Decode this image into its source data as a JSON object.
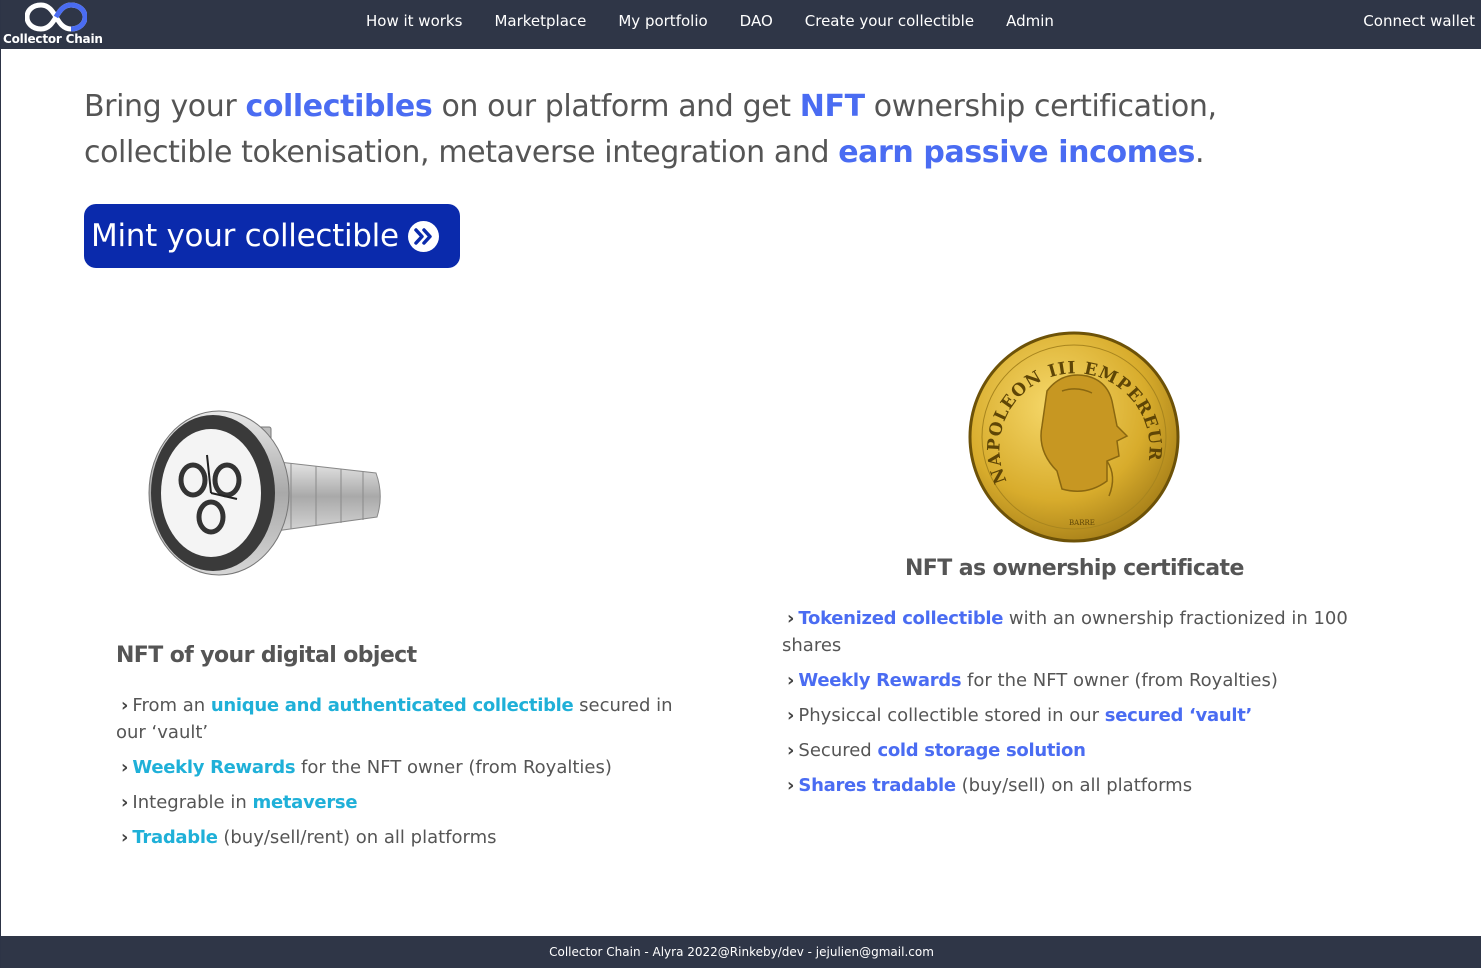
{
  "nav": {
    "brand_name": "Collector Chain",
    "links": [
      "How it works",
      "Marketplace",
      "My portfolio",
      "DAO",
      "Create your collectible",
      "Admin"
    ],
    "connect_label": "Connect wallet"
  },
  "hero": {
    "parts": [
      {
        "text": "Bring your ",
        "highlight": false
      },
      {
        "text": "collectibles",
        "highlight": true
      },
      {
        "text": " on our platform and get ",
        "highlight": false
      },
      {
        "text": "NFT",
        "highlight": true
      },
      {
        "text": " ownership certification, collectible tokenisation, metaverse integration and ",
        "highlight": false
      },
      {
        "text": "earn passive incomes",
        "highlight": true
      },
      {
        "text": ".",
        "highlight": false
      }
    ],
    "cta_label": "Mint your collectible",
    "cta_icon": "double-chevron-right-icon"
  },
  "left_card": {
    "image": "watch-image",
    "title": "NFT of your digital object",
    "features": [
      [
        {
          "t": "From an ",
          "h": false
        },
        {
          "t": "unique and authenticated collectible",
          "h": true
        },
        {
          "t": " secured in our ‘vault’",
          "h": false
        }
      ],
      [
        {
          "t": "Weekly Rewards",
          "h": true
        },
        {
          "t": " for the NFT owner (from Royalties)",
          "h": false
        }
      ],
      [
        {
          "t": "Integrable in ",
          "h": false
        },
        {
          "t": "metaverse",
          "h": true
        }
      ],
      [
        {
          "t": "Tradable",
          "h": true
        },
        {
          "t": " (buy/sell/rent) on all platforms",
          "h": false
        }
      ]
    ]
  },
  "right_card": {
    "image": "coin-image",
    "coin_inscription": "NAPOLEON III EMPEREUR",
    "coin_mark": "BARRE",
    "title": "NFT as ownership certificate",
    "features": [
      [
        {
          "t": "Tokenized collectible",
          "h": true
        },
        {
          "t": " with an ownership fractionized in 100 shares",
          "h": false
        }
      ],
      [
        {
          "t": "Weekly Rewards",
          "h": true
        },
        {
          "t": " for the NFT owner (from Royalties)",
          "h": false
        }
      ],
      [
        {
          "t": "Physiccal collectible stored in our ",
          "h": false
        },
        {
          "t": "secured ‘vault’",
          "h": true
        }
      ],
      [
        {
          "t": "Secured ",
          "h": false
        },
        {
          "t": "cold storage solution",
          "h": true
        }
      ],
      [
        {
          "t": "Shares tradable",
          "h": true
        },
        {
          "t": " (buy/sell) on all platforms",
          "h": false
        }
      ]
    ]
  },
  "footer": {
    "text": "Collector Chain - Alyra 2022@Rinkeby/dev - jejulien@gmail.com"
  },
  "colors": {
    "navbar": "#2f3647",
    "highlight_blue": "#4a6cf2",
    "highlight_cyan": "#1fb0d8",
    "cta": "#0a2aac"
  }
}
